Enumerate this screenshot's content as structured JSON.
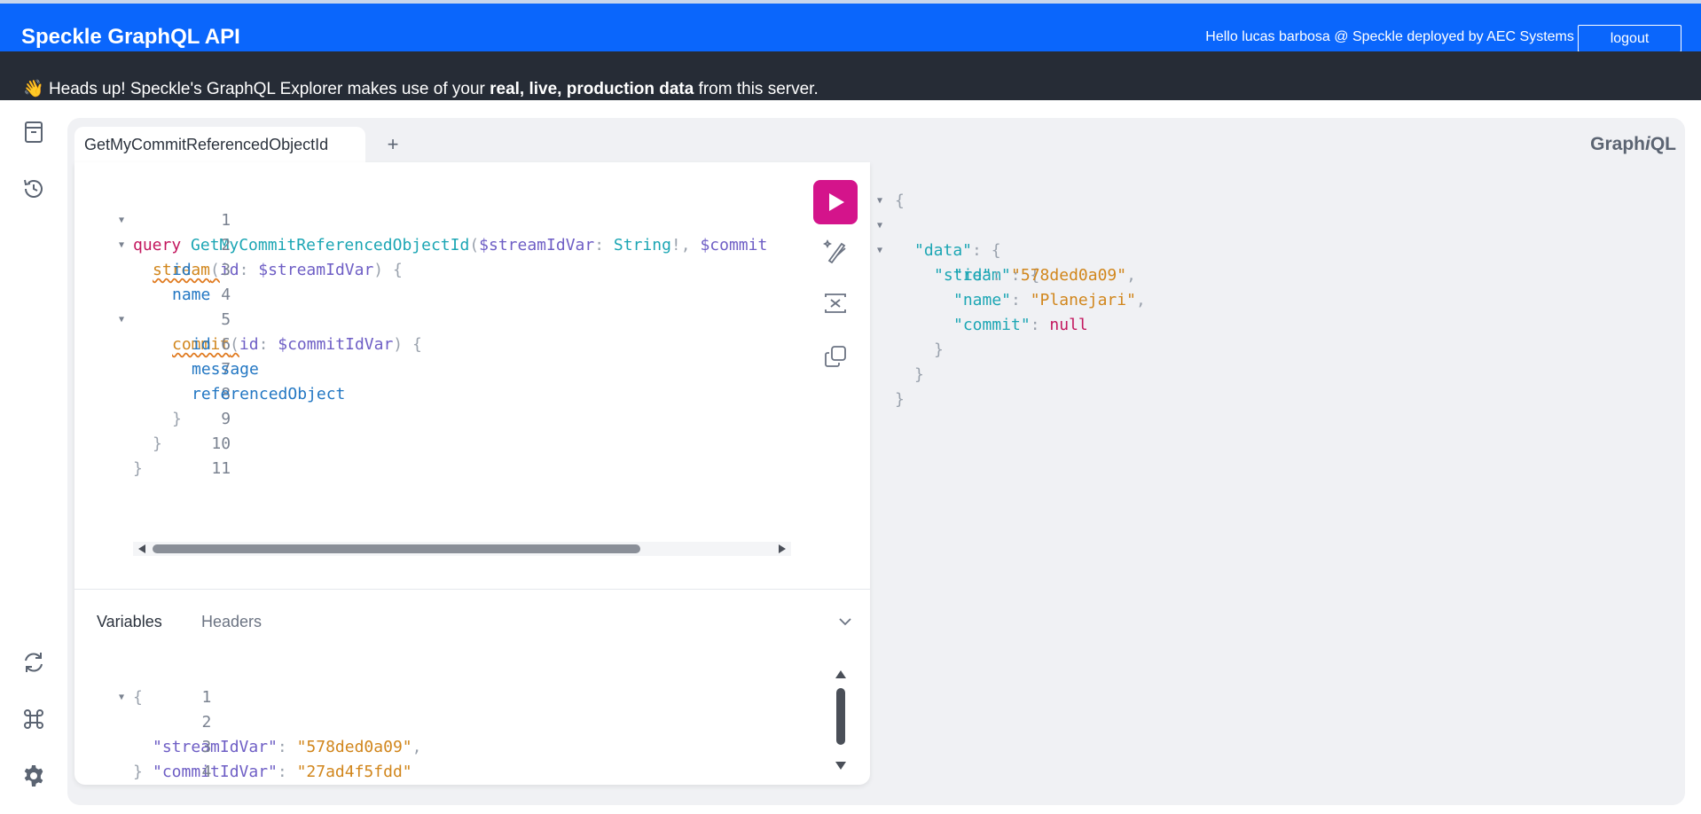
{
  "header": {
    "title": "Speckle GraphQL API",
    "greeting": "Hello lucas barbosa @ Speckle deployed by AEC Systems Ltd.",
    "logout_label": "logout",
    "accent": "#0a66fc"
  },
  "banner": {
    "emoji": "👋",
    "prefix": " Heads up! Speckle's GraphQL Explorer makes use of your ",
    "emphasis": "real, live, production data",
    "suffix": " from this server."
  },
  "sidebar": {
    "top_icons": [
      "docs-icon",
      "history-icon"
    ],
    "bottom_icons": [
      "refetch-schema-icon",
      "shortcuts-icon",
      "settings-icon"
    ]
  },
  "tabs": {
    "active_label": "GetMyCommitReferencedObjectId",
    "add_label": "+",
    "logo_prefix": "Graph",
    "logo_italic": "i",
    "logo_suffix": "QL"
  },
  "query": {
    "line_numbers": [
      "1",
      "2",
      "3",
      "4",
      "5",
      "6",
      "7",
      "8",
      "9",
      "10",
      "11"
    ],
    "l1_kw": "query",
    "l1_name": "GetMyCommitReferencedObjectId",
    "l1_paren": "(",
    "l1_var": "$streamIdVar",
    "l1_colon": ": ",
    "l1_type": "String",
    "l1_bang": "!",
    "l1_comma": ", ",
    "l1_var2": "$commit",
    "l2_field": "stream",
    "l2_paren": "(",
    "l2_arg": "id",
    "l2_colon": ": ",
    "l2_var": "$streamIdVar",
    "l2_close": ") {",
    "l3": "id",
    "l4": "name",
    "l5_field": "commit",
    "l5_paren": "(",
    "l5_arg": "id",
    "l5_colon": ": ",
    "l5_var": "$commitIdVar",
    "l5_close": ") {",
    "l6": "id",
    "l7": "message",
    "l8": "referencedObject",
    "l9": "}",
    "l10": "}",
    "l11": "}"
  },
  "tools": [
    "run-icon",
    "prettify-icon",
    "merge-fragments-icon",
    "copy-icon"
  ],
  "variables_panel": {
    "tab_variables": "Variables",
    "tab_headers": "Headers",
    "line_numbers": [
      "1",
      "2",
      "3",
      "4"
    ],
    "open": "{",
    "k1": "\"streamIdVar\"",
    "v1": "\"578ded0a09\"",
    "k2": "\"commitIdVar\"",
    "v2": "\"27ad4f5fdd\"",
    "close": "}"
  },
  "result": {
    "open": "{",
    "data_key": "\"data\"",
    "stream_key": "\"stream\"",
    "id_key": "\"id\"",
    "id_val": "\"578ded0a09\"",
    "name_key": "\"name\"",
    "name_val": "\"Planejari\"",
    "commit_key": "\"commit\"",
    "commit_val": "null",
    "brace": "{",
    "close": "}"
  }
}
